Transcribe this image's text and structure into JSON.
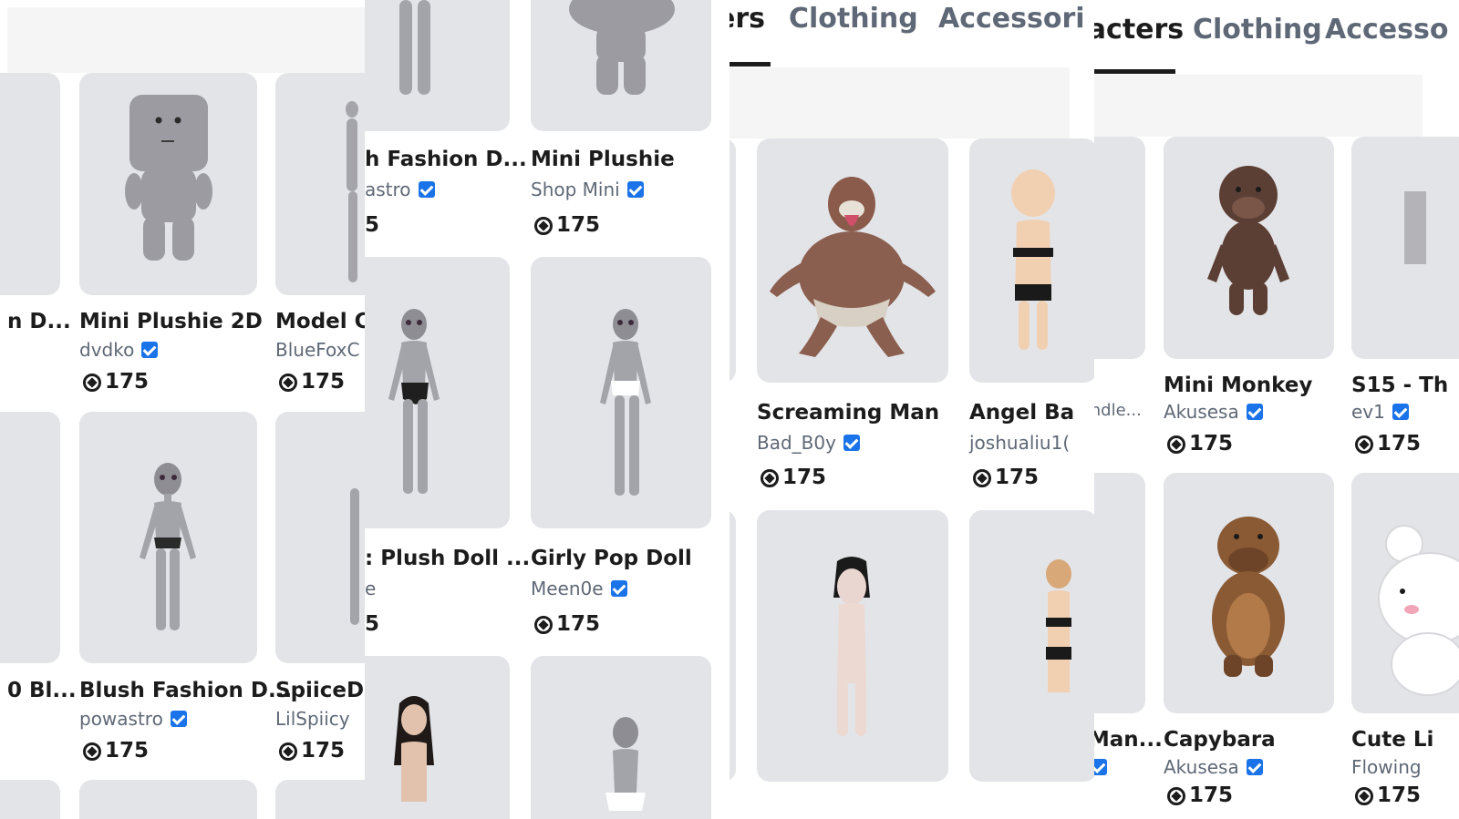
{
  "tabs": {
    "characters_partial_a": "ers",
    "characters_partial_b": "racters",
    "clothing": "Clothing",
    "accessories_partial_a": "Accessori",
    "accessories_partial_b": "Accesso"
  },
  "panel1": {
    "items": [
      {
        "name": "n D...",
        "creator": "",
        "price": ""
      },
      {
        "name": "Mini Plushie 2D",
        "creator": "dvdko",
        "price": "175"
      },
      {
        "name": "Model C",
        "creator": "BlueFoxC",
        "price": "175"
      },
      {
        "name": "0 Bl...",
        "creator": "",
        "price": ""
      },
      {
        "name": "Blush Fashion D...",
        "creator": "powastro",
        "price": "175"
      },
      {
        "name": "SpiiceD",
        "creator": "LilSpiicy",
        "price": "175"
      }
    ]
  },
  "panel2": {
    "items": [
      {
        "name": "h Fashion D...",
        "creator": "astro",
        "price": "5"
      },
      {
        "name": "Mini Plushie",
        "creator": "Shop Mini",
        "price": "175"
      },
      {
        "name": ": Plush Doll ...",
        "creator": "e",
        "price": "5"
      },
      {
        "name": "Girly Pop Doll",
        "creator": "Meen0e",
        "price": "175"
      }
    ]
  },
  "panel3": {
    "items": [
      {
        "name": "Screaming Man",
        "creator": "Bad_B0y",
        "price": "175"
      },
      {
        "name": "Angel Ba",
        "creator": "joshualiu1(",
        "price": "175"
      }
    ]
  },
  "panel4": {
    "items": [
      {
        "name": "Bundle...",
        "creator": "",
        "price": ""
      },
      {
        "name": "Mini Monkey",
        "creator": "Akusesa",
        "price": "175"
      },
      {
        "name": "S15 - Th",
        "creator": "ev1",
        "price": "175"
      },
      {
        "name": "l Man...",
        "creator": "v",
        "price": ""
      },
      {
        "name": "Capybara",
        "creator": "Akusesa",
        "price": "175"
      },
      {
        "name": "Cute Li",
        "creator": "Flowing",
        "price": "175"
      }
    ]
  },
  "icons": {
    "verified": "verified-badge-icon",
    "currency": "robux-icon"
  },
  "colors": {
    "verified": "#1a73e8",
    "thumbnail_bg": "#e3e4e8",
    "muted_text": "#5f6876"
  }
}
